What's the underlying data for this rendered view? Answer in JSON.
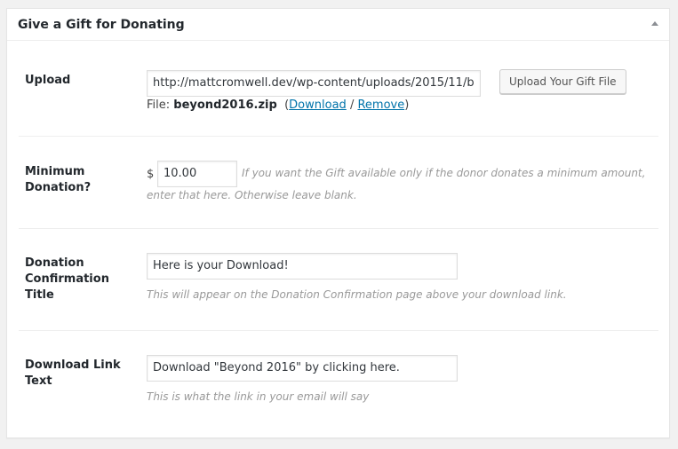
{
  "metabox": {
    "title": "Give a Gift for Donating"
  },
  "upload": {
    "label": "Upload",
    "url_value": "http://mattcromwell.dev/wp-content/uploads/2015/11/b",
    "button_label": "Upload Your Gift File",
    "file_prefix": "File:",
    "file_name": "beyond2016.zip",
    "open_paren": "(",
    "download_link": "Download",
    "separator": "/",
    "remove_link": "Remove",
    "close_paren": ")"
  },
  "minimum": {
    "label": "Minimum Donation?",
    "currency_symbol": "$",
    "value": "10.00",
    "description": "If you want the Gift available only if the donor donates a minimum amount, enter that here. Otherwise leave blank."
  },
  "confirmation_title": {
    "label": "Donation Confirmation Title",
    "value": "Here is your Download!",
    "description": "This will appear on the Donation Confirmation page above your download link."
  },
  "link_text": {
    "label": "Download Link Text",
    "value": "Download \"Beyond 2016\" by clicking here.",
    "description": "This is what the link in your email will say"
  }
}
